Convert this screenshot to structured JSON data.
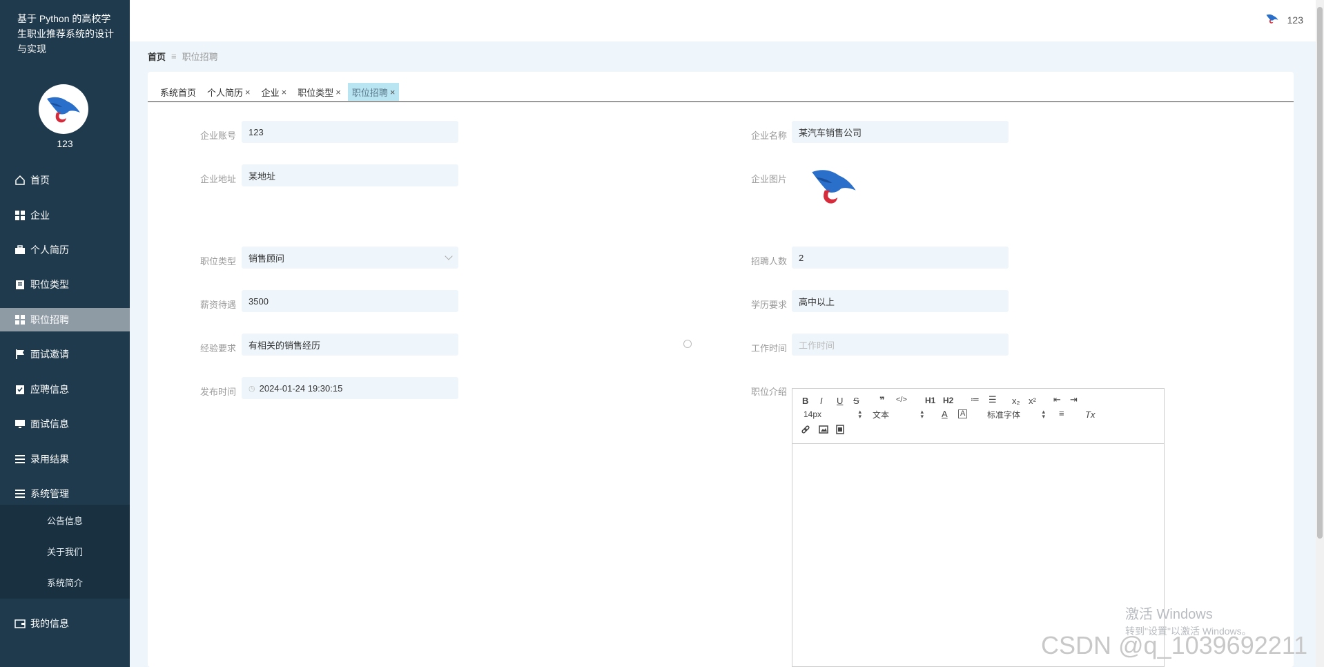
{
  "app": {
    "title": "基于 Python 的高校学生职业推荐系统的设计与实现"
  },
  "user": {
    "name": "123",
    "avatar_icon": "eagle-logo-icon"
  },
  "header": {
    "username": "123"
  },
  "sidebar": {
    "items": [
      {
        "label": "首页",
        "icon": "home-icon"
      },
      {
        "label": "企业",
        "icon": "grid-icon"
      },
      {
        "label": "个人简历",
        "icon": "briefcase-icon"
      },
      {
        "label": "职位类型",
        "icon": "clipboard-icon"
      },
      {
        "label": "职位招聘",
        "icon": "grid-icon",
        "active": true
      },
      {
        "label": "面试邀请",
        "icon": "flag-icon"
      },
      {
        "label": "应聘信息",
        "icon": "checklist-icon"
      },
      {
        "label": "面试信息",
        "icon": "monitor-icon"
      },
      {
        "label": "录用结果",
        "icon": "list-icon"
      },
      {
        "label": "系统管理",
        "icon": "list-icon"
      }
    ],
    "sub_items": [
      {
        "label": "公告信息"
      },
      {
        "label": "关于我们"
      },
      {
        "label": "系统简介"
      }
    ],
    "my_info": {
      "label": "我的信息",
      "icon": "wallet-icon"
    }
  },
  "breadcrumb": {
    "home": "首页",
    "current": "职位招聘"
  },
  "tabs": [
    {
      "label": "系统首页",
      "closable": false
    },
    {
      "label": "个人简历",
      "closable": true
    },
    {
      "label": "企业",
      "closable": true
    },
    {
      "label": "职位类型",
      "closable": true
    },
    {
      "label": "职位招聘",
      "closable": true,
      "active": true
    }
  ],
  "tab_close_glyph": "×",
  "form": {
    "company_account": {
      "label": "企业账号",
      "value": "123"
    },
    "company_name": {
      "label": "企业名称",
      "value": "某汽车销售公司"
    },
    "company_address": {
      "label": "企业地址",
      "value": "某地址"
    },
    "company_image": {
      "label": "企业图片"
    },
    "job_type": {
      "label": "职位类型",
      "value": "销售顾问"
    },
    "headcount": {
      "label": "招聘人数",
      "value": "2"
    },
    "salary": {
      "label": "薪资待遇",
      "value": "3500"
    },
    "education": {
      "label": "学历要求",
      "value": "高中以上"
    },
    "experience": {
      "label": "经验要求",
      "value": "有相关的销售经历"
    },
    "work_time": {
      "label": "工作时间",
      "value": "",
      "placeholder": "工作时间"
    },
    "publish_time": {
      "label": "发布时间",
      "value": "2024-01-24 19:30:15"
    },
    "job_intro": {
      "label": "职位介绍"
    }
  },
  "editor": {
    "buttons_row1": [
      "B",
      "I",
      "U",
      "S",
      "❞",
      "</>",
      "H1",
      "H2",
      "≔",
      "☰",
      "x₂",
      "x²",
      "⇤",
      "⇥"
    ],
    "font_size": "14px",
    "text_style": "文本",
    "font_family": "标准字体",
    "clear_format": "Tx"
  },
  "watermarks": {
    "windows_line1": "激活 Windows",
    "windows_line2": "转到\"设置\"以激活 Windows。",
    "csdn": "CSDN @q_1039692211"
  },
  "colors": {
    "sidebar_bg": "#1f3a4d",
    "active_item_bg": "#8e9aa4",
    "main_bg": "#eef6fb",
    "active_tab_bg": "#b9e5f3"
  }
}
